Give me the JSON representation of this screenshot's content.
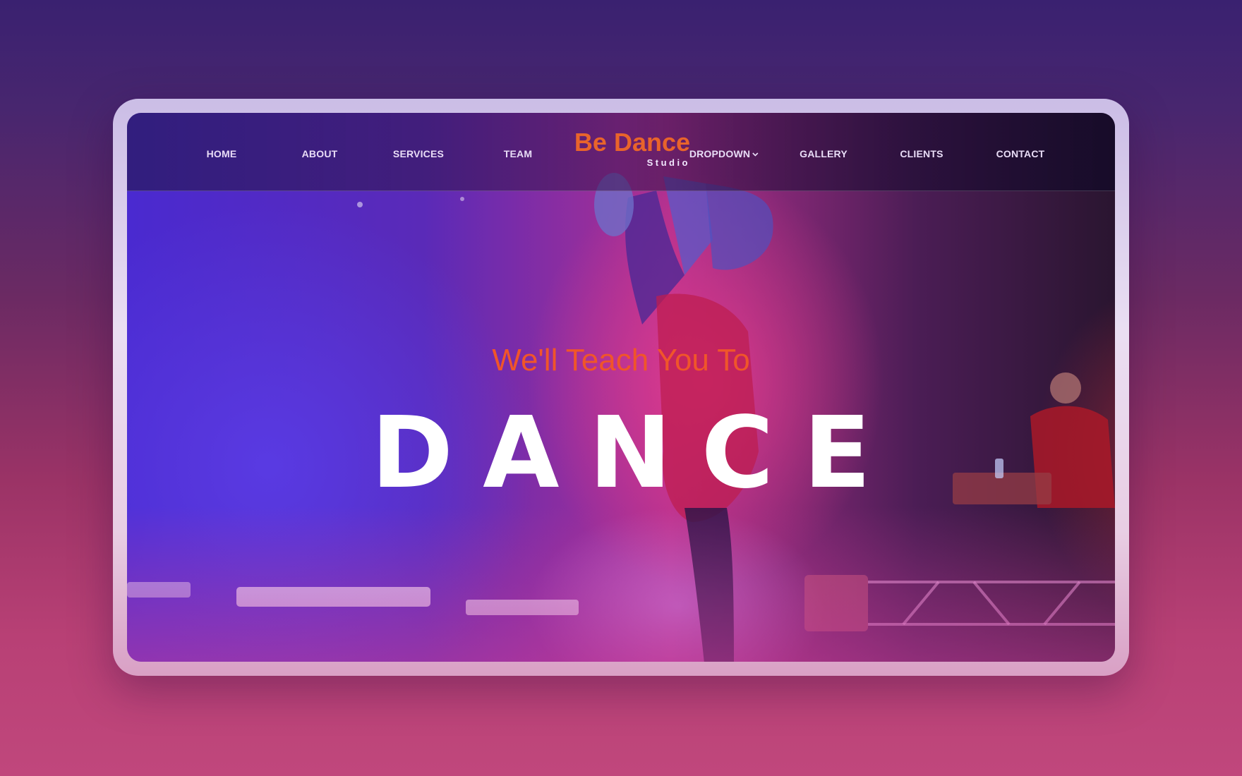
{
  "nav": {
    "items": [
      {
        "label": "HOME"
      },
      {
        "label": "ABOUT"
      },
      {
        "label": "SERVICES"
      },
      {
        "label": "TEAM"
      },
      {
        "label": "DROPDOWN"
      },
      {
        "label": "GALLERY"
      },
      {
        "label": "CLIENTS"
      },
      {
        "label": "CONTACT"
      }
    ]
  },
  "logo": {
    "title": "Be Dance",
    "subtitle": "Studio"
  },
  "hero": {
    "tagline": "We'll Teach You To",
    "headline": "DANCE"
  },
  "colors": {
    "accent": "#f0552a",
    "logo": "#e8642b",
    "heading": "#ffffff"
  },
  "icons": [
    "chevron-down-icon"
  ]
}
